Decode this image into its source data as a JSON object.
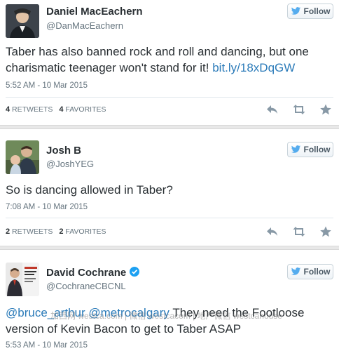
{
  "colors": {
    "link": "#2b7bb9",
    "verified": "#1da1f2",
    "bird": "#55acee"
  },
  "tweets": [
    {
      "name": "Daniel MacEachern",
      "handle": "@DanMacEachern",
      "verified": false,
      "follow_label": "Follow",
      "text": "Taber has also banned rock and roll and dancing, but one charismatic teenager won't stand for it! ",
      "link": "bit.ly/18xDqGW",
      "timestamp": "5:52 AM - 10 Mar 2015",
      "retweets": "4",
      "retweets_label": "RETWEETS",
      "favorites": "4",
      "favorites_label": "FAVORITES"
    },
    {
      "name": "Josh B",
      "handle": "@JoshYEG",
      "verified": false,
      "follow_label": "Follow",
      "text": "So is dancing allowed in Taber?",
      "timestamp": "7:08 AM - 10 Mar 2015",
      "retweets": "2",
      "retweets_label": "RETWEETS",
      "favorites": "2",
      "favorites_label": "FAVORITES"
    },
    {
      "name": "David Cochrane",
      "handle": "@CochraneCBCNL",
      "verified": true,
      "follow_label": "Follow",
      "mention1": "@bruce_arthur",
      "mention2": "@metrocalgary",
      "text": " They need the Footloose version of Kevin Bacon to get to Taber ASAP",
      "timestamp": "5:53 AM - 10 Mar 2015"
    }
  ],
  "watermark": "加西网 westca.com | 微信 westcacom | 地产微信 westcahouse",
  "icons": {
    "reply": "reply-icon",
    "retweet": "retweet-icon",
    "favorite": "star-icon",
    "follow": "twitter-bird-icon"
  }
}
